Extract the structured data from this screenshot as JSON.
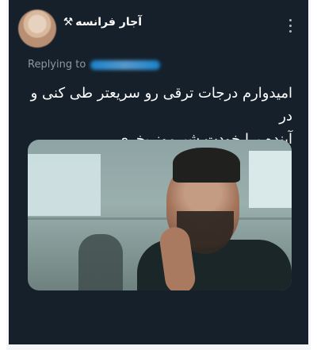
{
  "tweet": {
    "author": "آجار فرانسه",
    "author_icon": "hammer-and-wrench",
    "replying_prefix": "Replying to",
    "text_line_1": "امیدوارم درجات ترقی رو سریعتر طی کنی و در",
    "text_line_2": "آینده برا خودت شیرموز بخری"
  },
  "colors": {
    "background": "#15202b",
    "text": "#ffffff",
    "secondary_text": "#8b98a5",
    "accent": "#1d9bf0"
  }
}
